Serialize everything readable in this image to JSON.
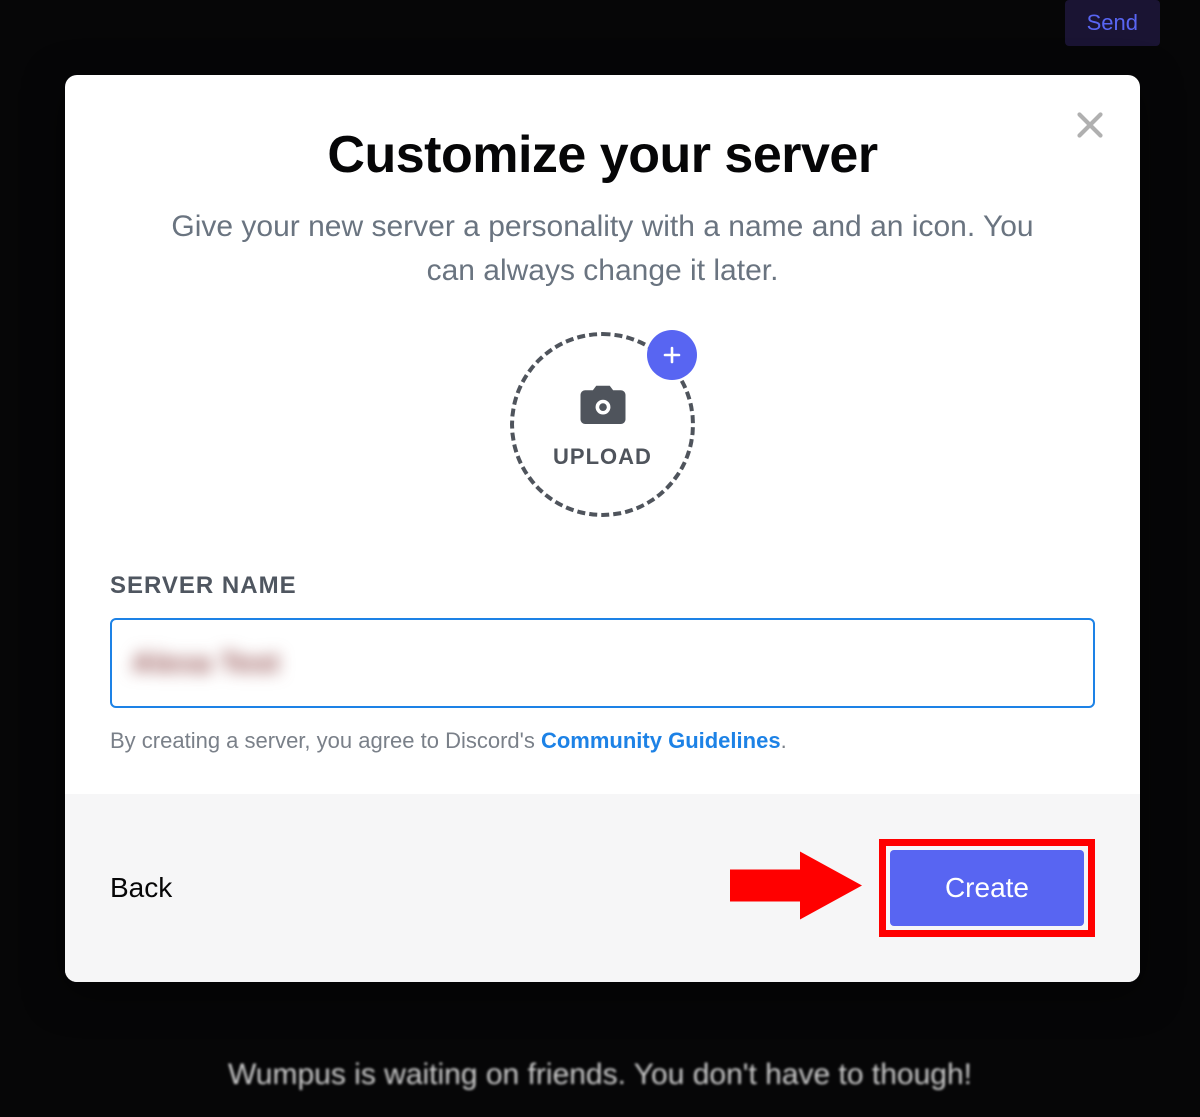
{
  "background": {
    "send_button": "Send",
    "wumpus_text": "Wumpus is waiting on friends. You don't have to though!"
  },
  "modal": {
    "title": "Customize your server",
    "subtitle": "Give your new server a personality with a name and an icon. You can always change it later.",
    "upload_label": "UPLOAD",
    "server_name_label": "SERVER NAME",
    "server_name_value": "Alexa Test",
    "guidelines_prefix": "By creating a server, you agree to Discord's ",
    "guidelines_link": "Community Guidelines",
    "guidelines_suffix": ".",
    "back_label": "Back",
    "create_label": "Create"
  },
  "colors": {
    "accent": "#5865f2",
    "link": "#1d82e6",
    "annotation": "#ff0000"
  }
}
